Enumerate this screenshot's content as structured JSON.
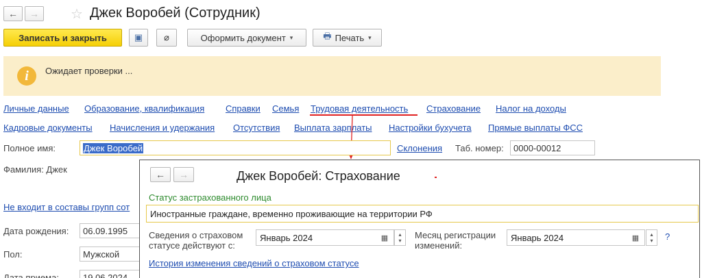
{
  "window": {
    "title": "Джек Воробей (Сотрудник)",
    "back_glyph": "←",
    "forward_glyph": "→",
    "favorite_glyph": "☆"
  },
  "toolbar": {
    "save_close_label": "Записать и закрыть",
    "save_glyph": "▣",
    "attach_glyph": "⌀",
    "make_document_label": "Оформить документ",
    "print_label": "Печать",
    "printer_glyph": "🖶",
    "dropdown_glyph": "▾"
  },
  "info": {
    "icon_glyph": "i",
    "text": "Ожидает проверки ..."
  },
  "links_row1": [
    "Личные данные",
    "Образование, квалификация",
    "Справки",
    "Семья",
    "Трудовая деятельность",
    "Страхование",
    "Налог на доходы"
  ],
  "links_row2": [
    "Кадровые документы",
    "Начисления и удержания",
    "Отсутствия",
    "Выплата зарплаты",
    "Настройки бухучета",
    "Прямые выплаты ФСС"
  ],
  "form": {
    "full_name_label": "Полное имя:",
    "full_name_value": "Джек Воробей",
    "declensions_link": "Склонения",
    "tab_number_label": "Таб. номер:",
    "tab_number_value": "0000-00012",
    "surname_label": "Фамилия: Джек",
    "groups_link": "Не входит в составы групп сот",
    "birth_date_label": "Дата рождения:",
    "birth_date_value": "06.09.1995",
    "gender_label": "Пол:",
    "gender_value": "Мужской",
    "hire_date_label": "Дата приема:",
    "hire_date_value": "19.06.2024"
  },
  "dialog": {
    "title": "Джек Воробей: Страхование",
    "status_label": "Статус застрахованного лица",
    "status_value": "Иностранные граждане, временно проживающие на территории РФ",
    "effective_label_line1": "Сведения о страховом",
    "effective_label_line2": "статусе действуют с:",
    "effective_value": "Январь 2024",
    "reg_month_label_line1": "Месяц регистрации",
    "reg_month_label_line2": "изменений:",
    "reg_month_value": "Январь 2024",
    "calendar_glyph": "▦",
    "spin_up": "▴",
    "spin_down": "▾",
    "help_glyph": "?",
    "history_link": "История изменения сведений о страховом статусе"
  },
  "colors": {
    "primary_button": "#f5cf05",
    "info_background": "#fbeeca",
    "link": "#1d4cb0",
    "annotation_red": "#e02020",
    "status_label_green": "#2e8b2e"
  }
}
